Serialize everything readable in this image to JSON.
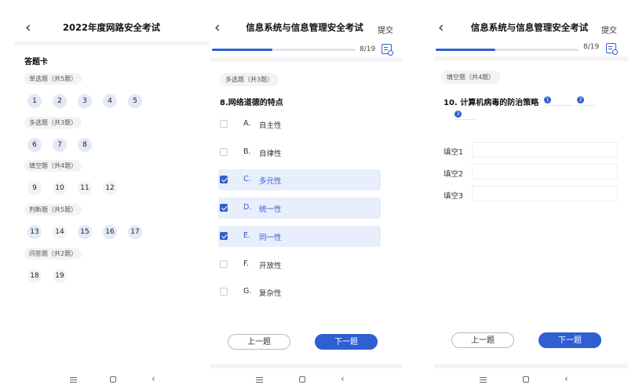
{
  "screen1": {
    "title": "2022年度网路安全考试",
    "card_title": "答题卡",
    "sections": [
      {
        "label": "单选题（共5题）",
        "items": [
          "1",
          "2",
          "3",
          "4",
          "5"
        ],
        "done": [
          true,
          true,
          true,
          true,
          true
        ]
      },
      {
        "label": "多选题（共3题）",
        "items": [
          "6",
          "7",
          "8"
        ],
        "done": [
          true,
          true,
          true
        ]
      },
      {
        "label": "填空题（共4题）",
        "items": [
          "9",
          "10",
          "11",
          "12"
        ],
        "done": [
          false,
          false,
          false,
          false
        ]
      },
      {
        "label": "判断题（共5题）",
        "items": [
          "13",
          "14",
          "15",
          "16",
          "17"
        ],
        "done": [
          true,
          false,
          true,
          true,
          true
        ]
      },
      {
        "label": "问答题（共2题）",
        "items": [
          "18",
          "19"
        ],
        "done": [
          false,
          false
        ]
      }
    ]
  },
  "screen2": {
    "title": "信息系统与信息管理安全考试",
    "submit": "提交",
    "progress": {
      "text": "8/19",
      "fraction": 0.42
    },
    "tag": "多选题（共3题）",
    "question": "8.网络道德的特点",
    "options": [
      {
        "letter": "A.",
        "text": "自主性",
        "selected": false
      },
      {
        "letter": "B.",
        "text": "自律性",
        "selected": false
      },
      {
        "letter": "C.",
        "text": "多元性",
        "selected": true
      },
      {
        "letter": "D.",
        "text": "统一性",
        "selected": true
      },
      {
        "letter": "E.",
        "text": "同一性",
        "selected": true
      },
      {
        "letter": "F.",
        "text": "开放性",
        "selected": false
      },
      {
        "letter": "G.",
        "text": "复杂性",
        "selected": false
      }
    ],
    "prev": "上一题",
    "next": "下一题"
  },
  "screen3": {
    "title": "信息系统与信息管理安全考试",
    "submit": "提交",
    "progress": {
      "text": "8/19",
      "fraction": 0.42
    },
    "tag": "填空题（共4题）",
    "question": "10. 计算机病毒的防治策略",
    "blanks": [
      "1",
      "2",
      "3"
    ],
    "fills": [
      "填空1",
      "填空2",
      "填空3"
    ],
    "prev": "上一题",
    "next": "下一题"
  },
  "icons": {
    "back": "chevron-left-icon",
    "card": "answer-card-icon",
    "menu": "menu-icon",
    "home": "home-icon",
    "nav_back": "back-icon"
  },
  "colors": {
    "accent": "#2f5fd0",
    "selected_bg": "#e8eefb",
    "answered_bg": "#e3e9f7"
  }
}
